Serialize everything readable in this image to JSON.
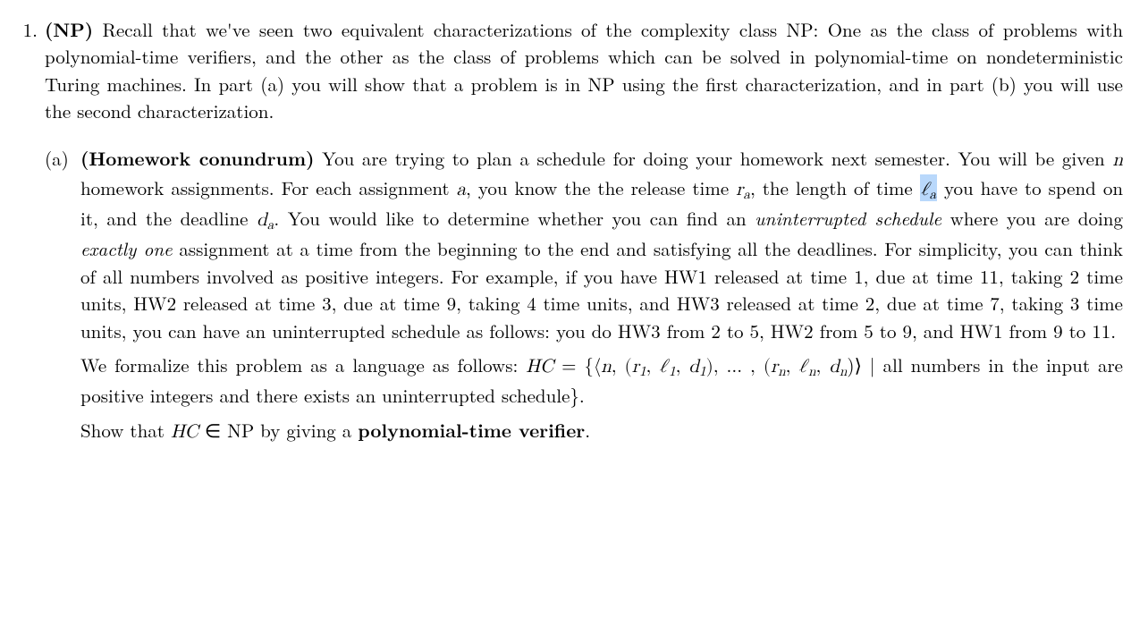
{
  "item": {
    "number": "1.",
    "lead_label": "(NP)",
    "intro": " Recall that we've seen two equivalent characterizations of the complexity class NP: One as the class of problems with polynomial-time verifiers, and the other as the class of problems which can be solved in polynomial-time on nondeterministic Turing machines. In part (a) you will show that a problem is in NP using the first characterization, and in part (b) you will use the second characterization."
  },
  "sub": {
    "label": "(a)",
    "title": "(Homework conundrum)",
    "p1_pre": " You are trying to plan a schedule for doing your homework next semester. You will be given ",
    "n_var": "n",
    "p1_mid1": " homework assignments. For each assignment ",
    "a_var": "a",
    "p1_mid2": ", you know the the release time ",
    "r_var": "r",
    "p1_mid3": ", the length of time ",
    "ell_var": "ℓ",
    "p1_mid4": " you have to spend on it, and the deadline ",
    "d_var": "d",
    "p1_mid5": ". You would like to determine whether you can find an ",
    "ital1": "uninterrupted schedule",
    "p1_mid6": " where you are doing ",
    "ital2": "exactly one",
    "p1_tail": " assignment at a time from the beginning to the end and satisfying all the deadlines. For simplicity, you can think of all numbers involved as positive integers. For example, if you have HW1 released at time 1, due at time 11, taking 2 time units, HW2 released at time 3, due at time 9, taking 4 time units, and HW3 released at time 2, due at time 7, taking 3 time units, you can have an uninterrupted schedule as follows: you do HW3 from 2 to 5, HW2 from 5 to 9, and HW1 from 9 to 11.",
    "p2_pre": "We formalize this problem as a language as follows:  ",
    "hc": "HC",
    "p2_eq1": " = {⟨",
    "p2_eq2": ", (",
    "p2_eq3": ", ",
    "p2_eq4": ", ",
    "p2_eq5": "), … , (",
    "p2_eq6": ", ",
    "p2_eq7": ", ",
    "p2_eq8": ")⟩ | all numbers in the input are positive integers and there exists an uninterrupted schedule}.",
    "sub1": "1",
    "subn": "n",
    "suba": "a",
    "p3_pre": "Show that ",
    "p3_in": " ∈ NP by giving a ",
    "p3_bold": "polynomial-time verifier",
    "p3_post": "."
  }
}
